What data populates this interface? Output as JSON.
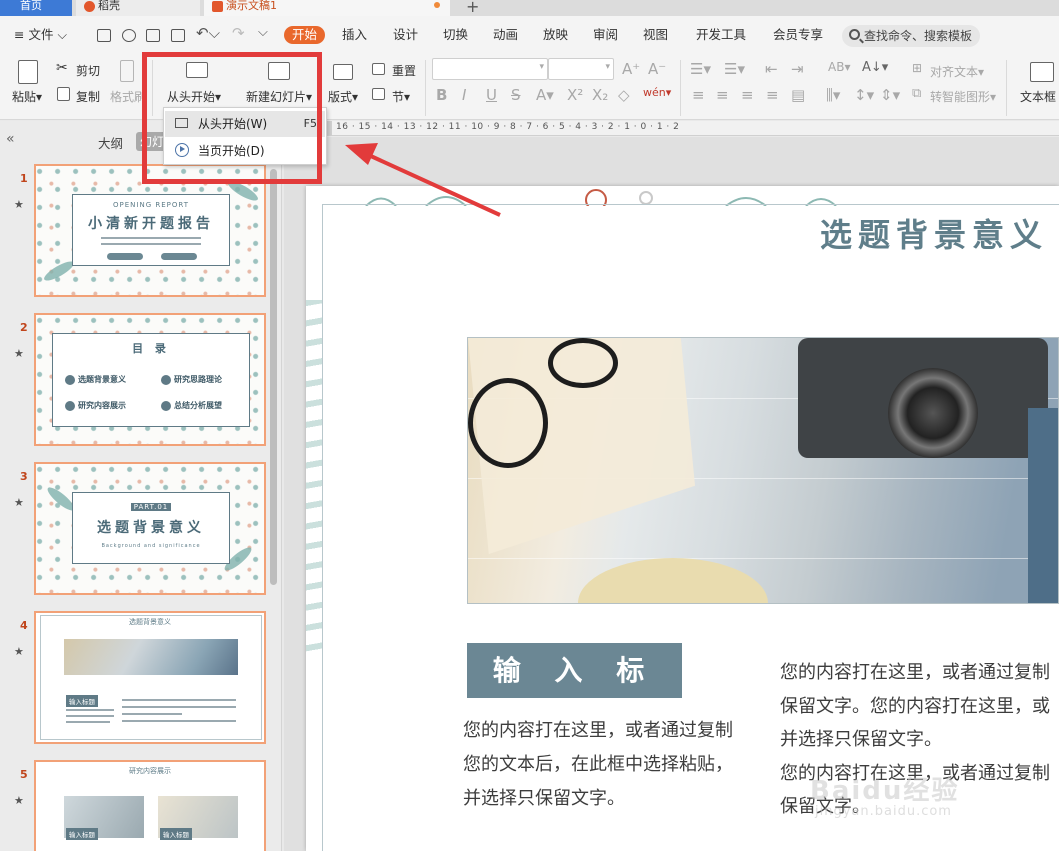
{
  "tabs": [
    {
      "label": "首页"
    },
    {
      "label": "稻壳"
    },
    {
      "label": "演示文稿1"
    }
  ],
  "menu": {
    "file": "文件",
    "items": [
      "开始",
      "插入",
      "设计",
      "切换",
      "动画",
      "放映",
      "审阅",
      "视图",
      "开发工具",
      "会员专享"
    ],
    "search_placeholder": "查找命令、搜索模板"
  },
  "ribbon": {
    "paste": "粘贴",
    "cut": "剪切",
    "copy": "复制",
    "format_painter": "格式刷",
    "from_start": "从头开始",
    "new_slide": "新建幻灯片",
    "layout": "版式",
    "reset": "重置",
    "section": "节",
    "text_align": "对齐文本",
    "smartart": "转智能图形",
    "textbox": "文本框"
  },
  "dropdown": {
    "item1_label": "从头开始(W)",
    "item1_shortcut": "F5",
    "item2_label": "当页开始(D)"
  },
  "panel": {
    "outline": "大纲",
    "slides": "幻灯"
  },
  "ruler_left": "16 · 15 · 14 · 13 · 12 · 11 · 10 · 9 · 8 · 7 · 6 · 5 · 4 · 3 · 2 · 1 · 0 · 1 · 2",
  "thumbs": [
    {
      "num": "1",
      "top_label": "OPENING REPORT",
      "title": "小清新开题报告"
    },
    {
      "num": "2",
      "title": "目 录",
      "items": [
        "选题背景意义",
        "研究思路理论",
        "研究内容展示",
        "总结分析展望"
      ]
    },
    {
      "num": "3",
      "top_label": "PART.01",
      "title": "选题背景意义",
      "sub": "Background and significance"
    },
    {
      "num": "4",
      "title": "选题背景意义",
      "label": "输入标题"
    },
    {
      "num": "5",
      "title": "研究内容展示",
      "label1": "输入标题",
      "label2": "输入标题"
    }
  ],
  "slide": {
    "title": "选题背景意义",
    "input_title": "输 入 标 题",
    "body_left": "您的内容打在这里，或者通过复制您的文本后，在此框中选择粘贴，并选择只保留文字。",
    "body_right": [
      "您的内容打在这里，或者通过复制",
      "保留文字。您的内容打在这里，或",
      "并选择只保留文字。",
      "您的内容打在这里，或者通过复制",
      "保留文字。"
    ]
  },
  "watermark": "Baidu经验",
  "watermark_sub": "jingyan.baidu.com",
  "colors": {
    "accent": "#e9682c",
    "highlight": "#e23b3b",
    "slide_title": "#5f7e8a",
    "title_box": "#6b8794"
  }
}
